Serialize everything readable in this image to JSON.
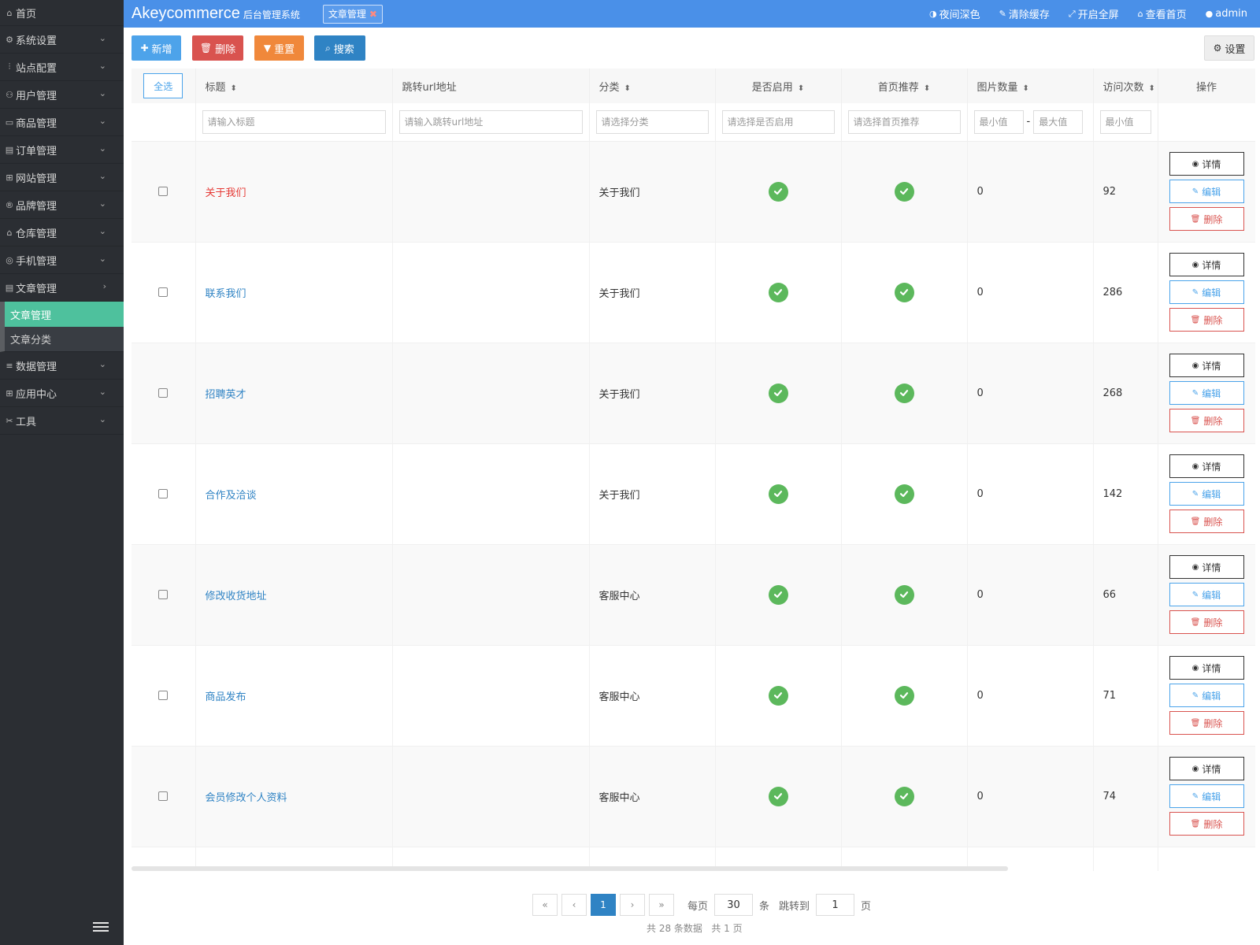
{
  "topbar": {
    "brand": "Akeycommerce",
    "brand_sub": "后台管理系统",
    "open_tab": "文章管理",
    "actions": [
      {
        "icon": "half-circle-icon",
        "label": "夜间深色"
      },
      {
        "icon": "brush-icon",
        "label": "清除缓存"
      },
      {
        "icon": "fullscreen-icon",
        "label": "开启全屏"
      },
      {
        "icon": "home-icon",
        "label": "查看首页"
      },
      {
        "icon": "user-icon",
        "label": "admin"
      }
    ]
  },
  "sidebar": {
    "items": [
      {
        "icon": "home-icon",
        "label": "首页"
      },
      {
        "icon": "gear-icon",
        "label": "系统设置"
      },
      {
        "icon": "sliders-icon",
        "label": "站点配置"
      },
      {
        "icon": "users-icon",
        "label": "用户管理"
      },
      {
        "icon": "goods-icon",
        "label": "商品管理"
      },
      {
        "icon": "order-icon",
        "label": "订单管理"
      },
      {
        "icon": "website-icon",
        "label": "网站管理"
      },
      {
        "icon": "brand-icon",
        "label": "品牌管理"
      },
      {
        "icon": "warehouse-icon",
        "label": "仓库管理"
      },
      {
        "icon": "phone-icon",
        "label": "手机管理"
      },
      {
        "icon": "article-icon",
        "label": "文章管理"
      }
    ],
    "submenu": [
      {
        "label": "文章管理",
        "active": true
      },
      {
        "label": "文章分类",
        "active": false
      }
    ],
    "items_after": [
      {
        "icon": "database-icon",
        "label": "数据管理"
      },
      {
        "icon": "apps-icon",
        "label": "应用中心"
      },
      {
        "icon": "tools-icon",
        "label": "工具"
      }
    ]
  },
  "toolbar": {
    "add": "新增",
    "delete": "删除",
    "reset": "重置",
    "search": "搜索",
    "settings": "设置"
  },
  "table": {
    "select_all": "全选",
    "columns": {
      "title": "标题",
      "url": "跳转url地址",
      "category": "分类",
      "enabled": "是否启用",
      "home": "首页推荐",
      "images": "图片数量",
      "visits": "访问次数",
      "ops": "操作"
    },
    "filters": {
      "title": "请输入标题",
      "url": "请输入跳转url地址",
      "category": "请选择分类",
      "enabled": "请选择是否启用",
      "home": "请选择首页推荐",
      "images_min": "最小值",
      "images_max": "最大值",
      "visits_min": "最小值"
    },
    "row_actions": {
      "view": "详情",
      "edit": "编辑",
      "delete": "删除"
    },
    "rows": [
      {
        "title": "关于我们",
        "url": "",
        "category": "关于我们",
        "enabled": true,
        "home": true,
        "images": "0",
        "visits": "92",
        "highlight": true
      },
      {
        "title": "联系我们",
        "url": "",
        "category": "关于我们",
        "enabled": true,
        "home": true,
        "images": "0",
        "visits": "286"
      },
      {
        "title": "招聘英才",
        "url": "",
        "category": "关于我们",
        "enabled": true,
        "home": true,
        "images": "0",
        "visits": "268"
      },
      {
        "title": "合作及洽谈",
        "url": "",
        "category": "关于我们",
        "enabled": true,
        "home": true,
        "images": "0",
        "visits": "142"
      },
      {
        "title": "修改收货地址",
        "url": "",
        "category": "客服中心",
        "enabled": true,
        "home": true,
        "images": "0",
        "visits": "66"
      },
      {
        "title": "商品发布",
        "url": "",
        "category": "客服中心",
        "enabled": true,
        "home": true,
        "images": "0",
        "visits": "71"
      },
      {
        "title": "会员修改个人资料",
        "url": "",
        "category": "客服中心",
        "enabled": true,
        "home": true,
        "images": "0",
        "visits": "74"
      },
      {
        "title": "",
        "url": "",
        "category": "",
        "enabled": null,
        "home": null,
        "images": "",
        "visits": "",
        "partial": true
      }
    ]
  },
  "pager": {
    "first": "«",
    "prev": "‹",
    "current": "1",
    "next": "›",
    "last": "»",
    "per_page_label": "每页",
    "per_page": "30",
    "per_page_unit": "条",
    "jump_label": "跳转到",
    "jump_value": "1",
    "page_unit": "页",
    "summary": "共 28 条数据   共 1 页"
  },
  "colors": {
    "topbar": "#4a90e8",
    "sidebar": "#2b2e33",
    "active_menu": "#4ec19d",
    "check_green": "#5cb85c"
  }
}
